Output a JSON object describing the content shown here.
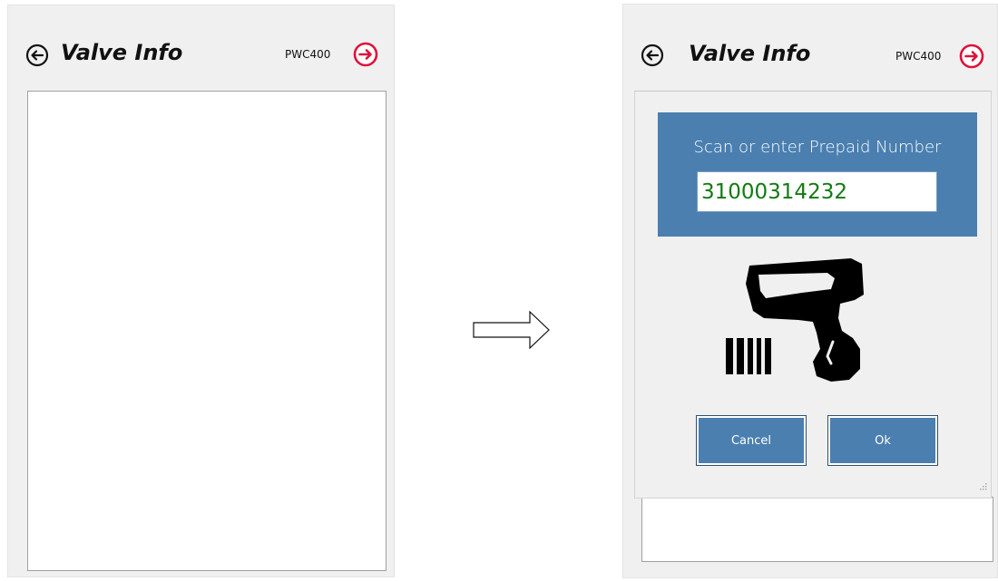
{
  "left_screen": {
    "title": "Valve Info",
    "device": "PWC400",
    "icons": {
      "back": "circle-arrow-left-icon",
      "next": "circle-arrow-right-icon"
    }
  },
  "right_screen": {
    "title": "Valve Info",
    "device": "PWC400",
    "icons": {
      "back": "circle-arrow-left-icon",
      "next": "circle-arrow-right-icon"
    },
    "dialog": {
      "prompt": "Scan or enter Prepaid Number",
      "prepaid_value": "31000314232",
      "cancel_label": "Cancel",
      "ok_label": "Ok",
      "art": "barcode-scanner-icon"
    }
  },
  "transition_arrow": "right-arrow-icon",
  "colors": {
    "accent_blue": "#4a7fb0",
    "next_red": "#e0103a",
    "input_text_green": "#127a12",
    "panel_gray": "#f0f0f0"
  }
}
